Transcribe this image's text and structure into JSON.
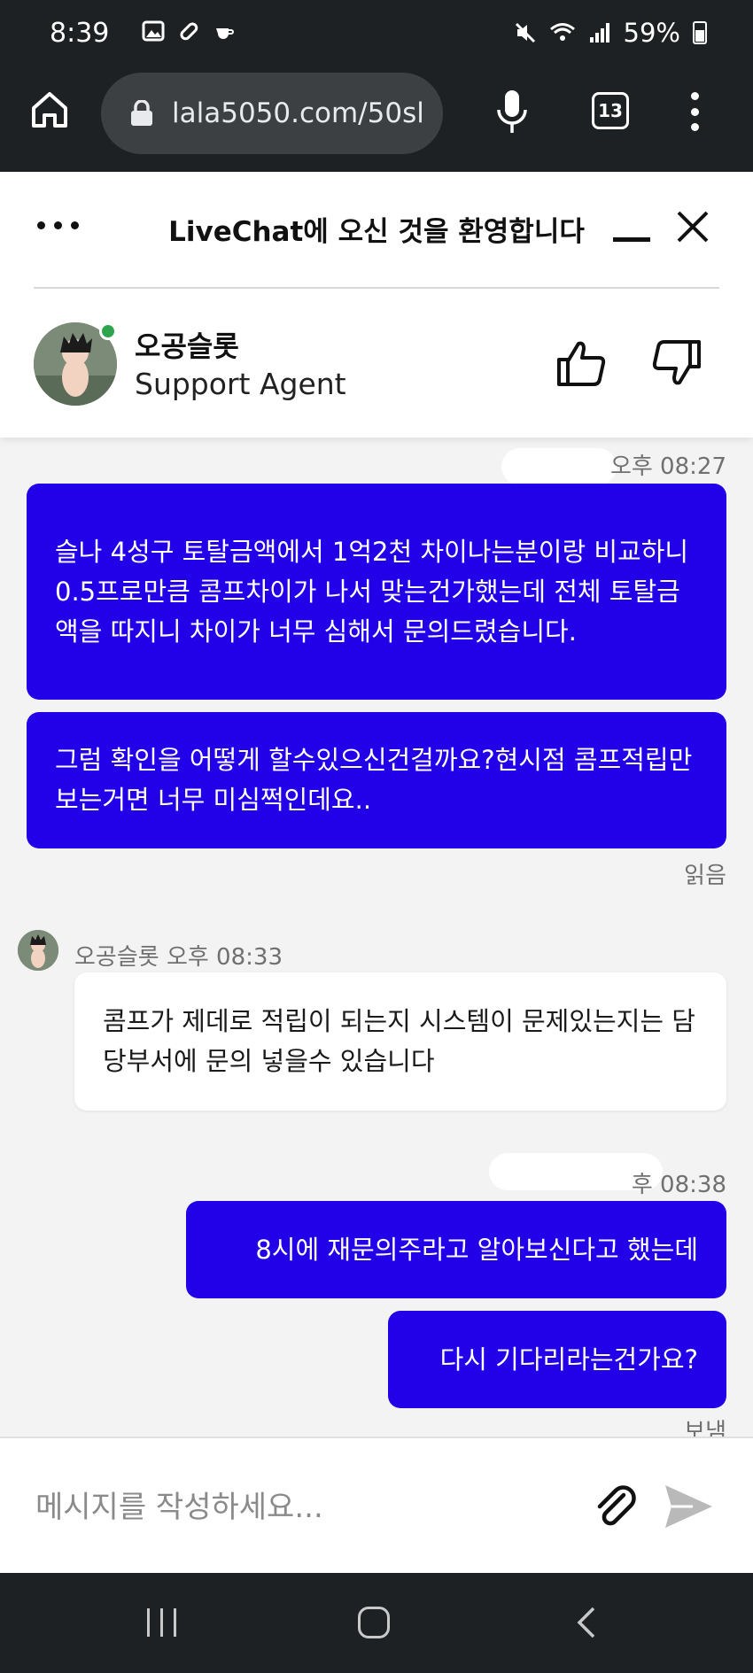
{
  "status_bar": {
    "time": "8:39",
    "battery": "59%",
    "battery_level": 0.59
  },
  "browser": {
    "url": "lala5050.com/50sl",
    "tab_count": "13"
  },
  "header": {
    "title": "LiveChat에 오신 것을 환영합니다",
    "agent_name": "오공슬롯",
    "agent_role": "Support Agent"
  },
  "messages": [
    {
      "sender": "me",
      "time": "오후 08:27",
      "text": "슬나 4성구 토탈금액에서 1억2천 차이나는분이랑 비교하니 0.5프로만큼 콤프차이가 나서 맞는건가했는데 전체 토탈금액을 따지니 차이가 너무 심해서 문의드렸습니다."
    },
    {
      "sender": "me",
      "text": "그럼 확인을 어떻게 할수있으신건걸까요?현시점 콤프적립만 보는거면 너무 미심쩍인데요..",
      "status": "읽음"
    },
    {
      "sender": "agent",
      "name": "오공슬롯",
      "time": "오후 08:33",
      "text": "콤프가 제데로 적립이 되는지 시스템이 문제있는지는 담당부서에 문의 넣을수 있습니다"
    },
    {
      "sender": "me",
      "time": "후 08:38",
      "text": "8시에 재문의주라고 알아보신다고 했는데"
    },
    {
      "sender": "me",
      "text": "다시 기다리라는건가요?",
      "status": "보냄"
    }
  ],
  "composer": {
    "placeholder": "메시지를 작성하세요..."
  },
  "colors": {
    "my_bubble": "#2200e8",
    "online": "#2ea44f"
  }
}
